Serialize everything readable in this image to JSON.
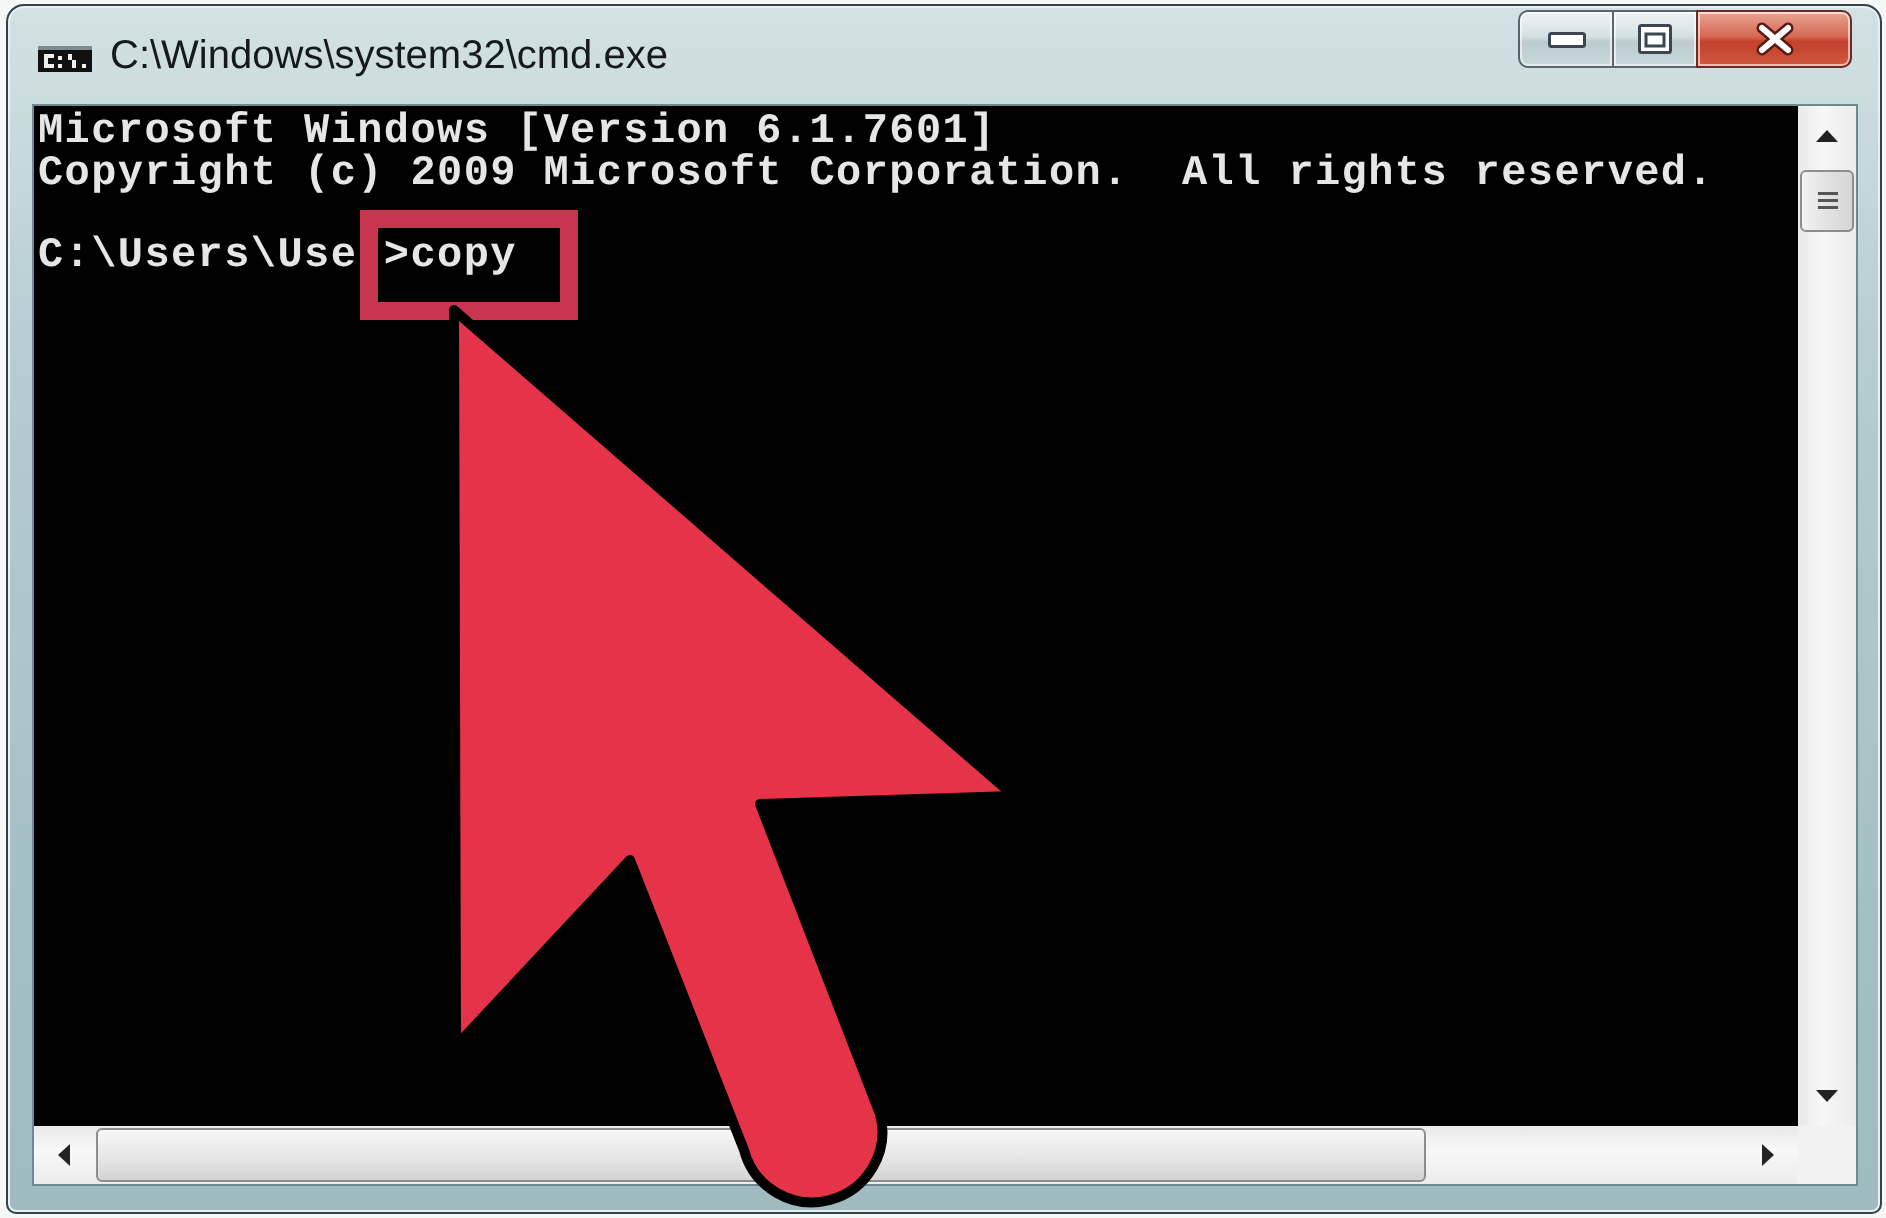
{
  "window": {
    "title": "C:\\Windows\\system32\\cmd.exe"
  },
  "console": {
    "output_lines": [
      "Microsoft Windows [Version 6.1.7601]",
      "Copyright (c) 2009 Microsoft Corporation.  All rights reserved."
    ],
    "prompt": {
      "path": "C:\\Users\\Use",
      "command": ">copy",
      "highlighted": true
    }
  }
}
